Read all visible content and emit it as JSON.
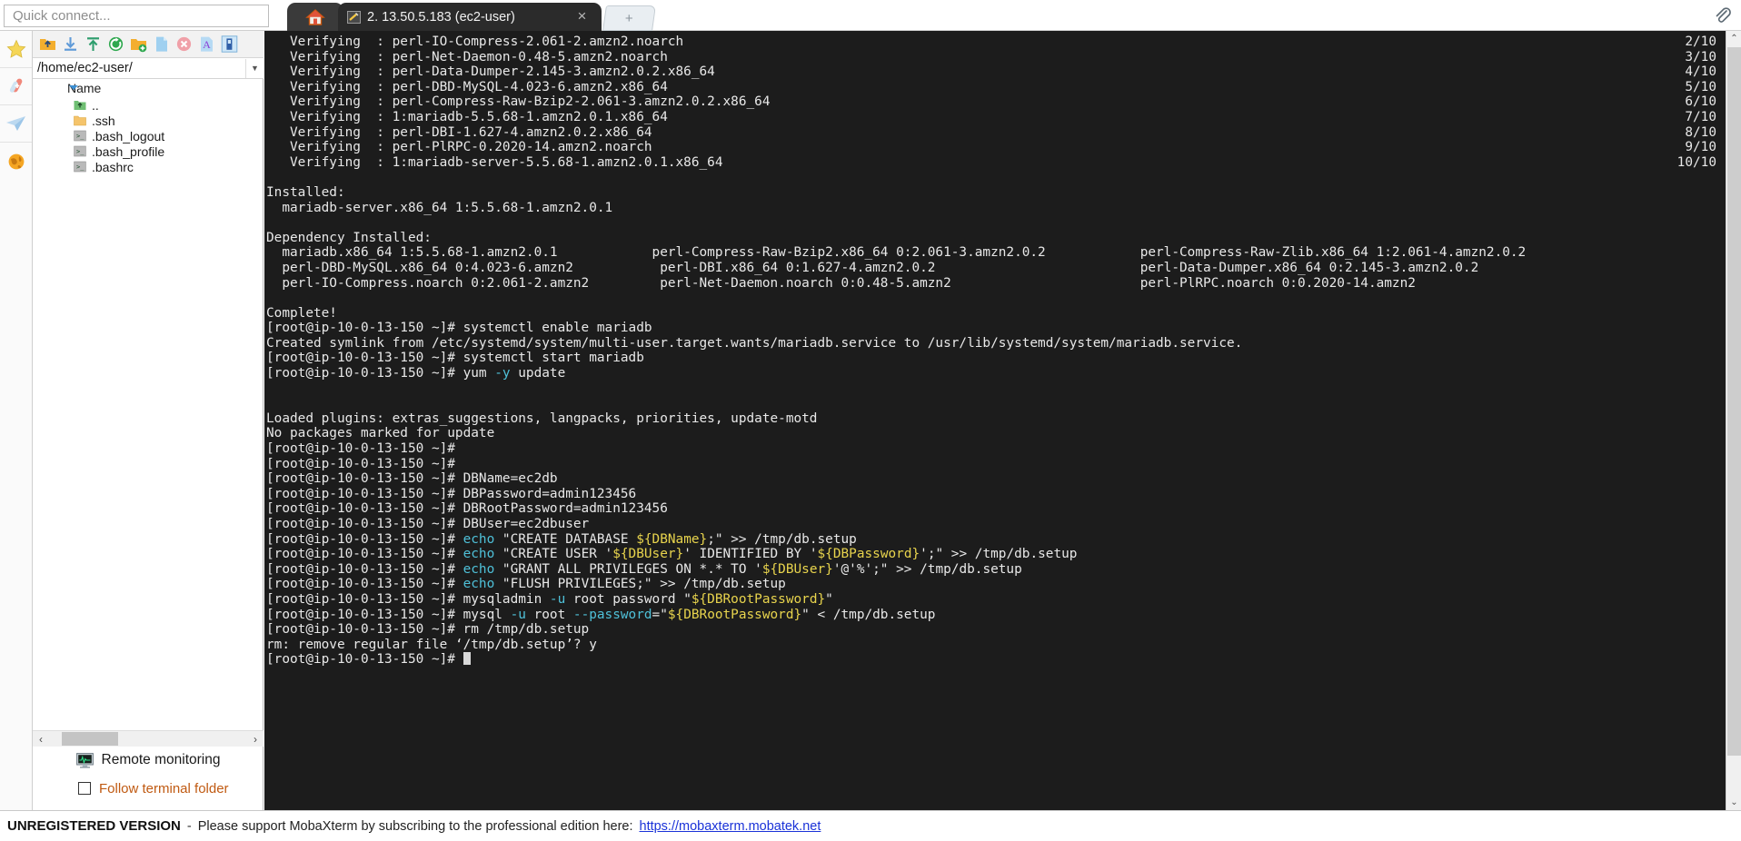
{
  "window": {
    "quick_connect_placeholder": "Quick connect..."
  },
  "tabs": {
    "home_icon": "home-icon",
    "active": {
      "icon": "terminal-session-icon",
      "label": "2. 13.50.5.183 (ec2-user)",
      "close": "×"
    },
    "new_tab_label": "+",
    "paperclip_icon": "paperclip-icon"
  },
  "rail": {
    "items": [
      {
        "name": "bookmarks",
        "icon": "star-icon"
      },
      {
        "name": "tools",
        "icon": "swiss-knife-icon"
      },
      {
        "name": "sessions",
        "icon": "paper-plane-icon"
      },
      {
        "name": "globe",
        "icon": "globe-icon"
      }
    ]
  },
  "sftp": {
    "toolbar": [
      {
        "name": "parent-folder",
        "icon": "up-folder-icon"
      },
      {
        "name": "download",
        "icon": "download-icon"
      },
      {
        "name": "upload",
        "icon": "upload-icon"
      },
      {
        "name": "refresh",
        "icon": "refresh-icon"
      },
      {
        "name": "new-folder",
        "icon": "new-folder-icon"
      },
      {
        "name": "new-file",
        "icon": "new-file-icon"
      },
      {
        "name": "delete",
        "icon": "delete-icon"
      },
      {
        "name": "text-editor",
        "icon": "text-editor-icon"
      },
      {
        "name": "toggle-panel",
        "icon": "panel-icon"
      }
    ],
    "path": "/home/ec2-user/",
    "column_header": "Name",
    "files": [
      {
        "name": "..",
        "icon": "parent-dir-icon"
      },
      {
        "name": ".ssh",
        "icon": "folder-icon"
      },
      {
        "name": ".bash_logout",
        "icon": "script-file-icon"
      },
      {
        "name": ".bash_profile",
        "icon": "script-file-icon"
      },
      {
        "name": ".bashrc",
        "icon": "script-file-icon"
      }
    ],
    "scroll_left": "‹",
    "scroll_right": "›",
    "remote_monitoring": "Remote monitoring",
    "follow_terminal_folder": "Follow terminal folder",
    "follow_checked": false
  },
  "colors": {
    "terminal_bg": "#1c1c1c",
    "terminal_fg": "#e8e8e8",
    "cyan": "#4fc1d9",
    "yellow": "#e8d44d",
    "link": "#1a32d8",
    "orange_text": "#c05a12"
  },
  "terminal": {
    "prompt": "[root@ip-10-0-13-150 ~]# ",
    "lines": [
      {
        "t": "plain",
        "text": "   Verifying  : perl-IO-Compress-2.061-2.amzn2.noarch",
        "right": "2/10"
      },
      {
        "t": "plain",
        "text": "   Verifying  : perl-Net-Daemon-0.48-5.amzn2.noarch",
        "right": "3/10"
      },
      {
        "t": "plain",
        "text": "   Verifying  : perl-Data-Dumper-2.145-3.amzn2.0.2.x86_64",
        "right": "4/10"
      },
      {
        "t": "plain",
        "text": "   Verifying  : perl-DBD-MySQL-4.023-6.amzn2.x86_64",
        "right": "5/10"
      },
      {
        "t": "plain",
        "text": "   Verifying  : perl-Compress-Raw-Bzip2-2.061-3.amzn2.0.2.x86_64",
        "right": "6/10"
      },
      {
        "t": "plain",
        "text": "   Verifying  : 1:mariadb-5.5.68-1.amzn2.0.1.x86_64",
        "right": "7/10"
      },
      {
        "t": "plain",
        "text": "   Verifying  : perl-DBI-1.627-4.amzn2.0.2.x86_64",
        "right": "8/10"
      },
      {
        "t": "plain",
        "text": "   Verifying  : perl-PlRPC-0.2020-14.amzn2.noarch",
        "right": "9/10"
      },
      {
        "t": "plain",
        "text": "   Verifying  : 1:mariadb-server-5.5.68-1.amzn2.0.1.x86_64",
        "right": "10/10"
      },
      {
        "t": "plain",
        "text": ""
      },
      {
        "t": "plain",
        "text": "Installed:"
      },
      {
        "t": "plain",
        "text": "  mariadb-server.x86_64 1:5.5.68-1.amzn2.0.1"
      },
      {
        "t": "plain",
        "text": ""
      },
      {
        "t": "plain",
        "text": "Dependency Installed:"
      },
      {
        "t": "plain",
        "text": "  mariadb.x86_64 1:5.5.68-1.amzn2.0.1            perl-Compress-Raw-Bzip2.x86_64 0:2.061-3.amzn2.0.2            perl-Compress-Raw-Zlib.x86_64 1:2.061-4.amzn2.0.2"
      },
      {
        "t": "plain",
        "text": "  perl-DBD-MySQL.x86_64 0:4.023-6.amzn2           perl-DBI.x86_64 0:1.627-4.amzn2.0.2                          perl-Data-Dumper.x86_64 0:2.145-3.amzn2.0.2"
      },
      {
        "t": "plain",
        "text": "  perl-IO-Compress.noarch 0:2.061-2.amzn2         perl-Net-Daemon.noarch 0:0.48-5.amzn2                        perl-PlRPC.noarch 0:0.2020-14.amzn2"
      },
      {
        "t": "plain",
        "text": ""
      },
      {
        "t": "plain",
        "text": "Complete!"
      },
      {
        "t": "prompt",
        "cmd": "systemctl enable mariadb"
      },
      {
        "t": "plain",
        "text": "Created symlink from /etc/systemd/system/multi-user.target.wants/mariadb.service to /usr/lib/systemd/system/mariadb.service."
      },
      {
        "t": "prompt",
        "cmd": "systemctl start mariadb"
      },
      {
        "t": "rich",
        "prompt": true,
        "parts": [
          {
            "c": "",
            "s": "yum "
          },
          {
            "c": "cy",
            "s": "-y"
          },
          {
            "c": "",
            "s": " update"
          }
        ]
      },
      {
        "t": "plain",
        "text": ""
      },
      {
        "t": "plain",
        "text": ""
      },
      {
        "t": "plain",
        "text": "Loaded plugins: extras_suggestions, langpacks, priorities, update-motd"
      },
      {
        "t": "plain",
        "text": "No packages marked for update"
      },
      {
        "t": "prompt",
        "cmd": ""
      },
      {
        "t": "prompt",
        "cmd": ""
      },
      {
        "t": "prompt",
        "cmd": "DBName=ec2db"
      },
      {
        "t": "prompt",
        "cmd": "DBPassword=admin123456"
      },
      {
        "t": "prompt",
        "cmd": "DBRootPassword=admin123456"
      },
      {
        "t": "prompt",
        "cmd": "DBUser=ec2dbuser"
      },
      {
        "t": "rich",
        "prompt": true,
        "parts": [
          {
            "c": "cy",
            "s": "echo"
          },
          {
            "c": "",
            "s": " \"CREATE DATABASE "
          },
          {
            "c": "ye",
            "s": "${DBName}"
          },
          {
            "c": "",
            "s": ";\" >> /tmp/db.setup"
          }
        ]
      },
      {
        "t": "rich",
        "prompt": true,
        "parts": [
          {
            "c": "cy",
            "s": "echo"
          },
          {
            "c": "",
            "s": " \"CREATE USER '"
          },
          {
            "c": "ye",
            "s": "${DBUser}"
          },
          {
            "c": "",
            "s": "' IDENTIFIED BY '"
          },
          {
            "c": "ye",
            "s": "${DBPassword}"
          },
          {
            "c": "",
            "s": "';\" >> /tmp/db.setup"
          }
        ]
      },
      {
        "t": "rich",
        "prompt": true,
        "parts": [
          {
            "c": "cy",
            "s": "echo"
          },
          {
            "c": "",
            "s": " \"GRANT ALL PRIVILEGES ON *.* TO '"
          },
          {
            "c": "ye",
            "s": "${DBUser}"
          },
          {
            "c": "",
            "s": "'@'%';\" >> /tmp/db.setup"
          }
        ]
      },
      {
        "t": "rich",
        "prompt": true,
        "parts": [
          {
            "c": "cy",
            "s": "echo"
          },
          {
            "c": "",
            "s": " \"FLUSH PRIVILEGES;\" >> /tmp/db.setup"
          }
        ]
      },
      {
        "t": "rich",
        "prompt": true,
        "parts": [
          {
            "c": "",
            "s": "mysqladmin "
          },
          {
            "c": "cy",
            "s": "-u"
          },
          {
            "c": "",
            "s": " root password \""
          },
          {
            "c": "ye",
            "s": "${DBRootPassword}"
          },
          {
            "c": "",
            "s": "\""
          }
        ]
      },
      {
        "t": "rich",
        "prompt": true,
        "parts": [
          {
            "c": "",
            "s": "mysql "
          },
          {
            "c": "cy",
            "s": "-u"
          },
          {
            "c": "",
            "s": " root "
          },
          {
            "c": "cy",
            "s": "--password"
          },
          {
            "c": "",
            "s": "=\""
          },
          {
            "c": "ye",
            "s": "${DBRootPassword}"
          },
          {
            "c": "",
            "s": "\" < /tmp/db.setup"
          }
        ]
      },
      {
        "t": "prompt",
        "cmd": "rm /tmp/db.setup"
      },
      {
        "t": "plain",
        "text": "rm: remove regular file ‘/tmp/db.setup’? y"
      },
      {
        "t": "prompt",
        "cmd": "",
        "cursor": true
      }
    ]
  },
  "scrollbar": {
    "up_arrow": "⌃",
    "down_arrow": "⌄"
  },
  "statusbar": {
    "unregistered": "UNREGISTERED VERSION",
    "dash": "-",
    "message": "Please support MobaXterm by subscribing to the professional edition here:",
    "link": "https://mobaxterm.mobatek.net"
  }
}
